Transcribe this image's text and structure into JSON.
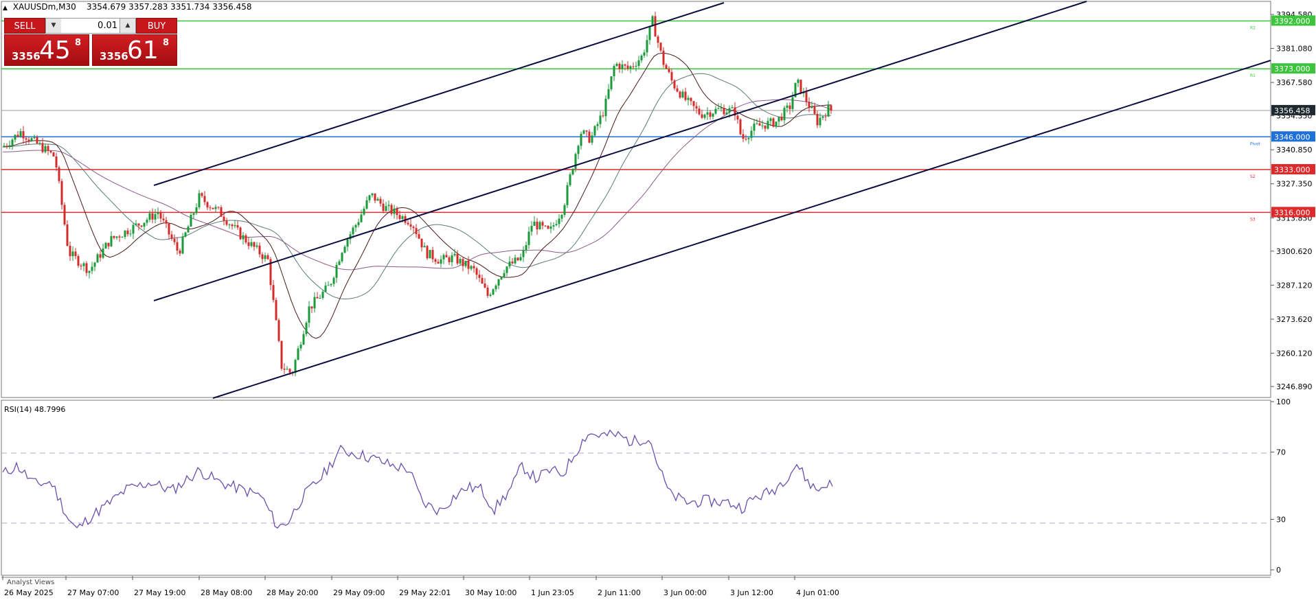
{
  "header": {
    "symbol_info": "XAUUSDm,M30",
    "ohlc": "3354.679 3357.283 3351.734 3356.458"
  },
  "trade_panel": {
    "sell_label": "SELL",
    "buy_label": "BUY",
    "lot_value": "0.01",
    "sell_price": {
      "prefix": "3356",
      "big": "45",
      "sup": "8"
    },
    "buy_price": {
      "prefix": "3356",
      "big": "61",
      "sup": "8"
    }
  },
  "price_axis": {
    "ticks": [
      "3394.580",
      "3381.080",
      "3367.580",
      "3354.350",
      "3340.850",
      "3327.350",
      "3313.850",
      "3300.620",
      "3287.120",
      "3273.620",
      "3260.120",
      "3246.890"
    ]
  },
  "levels": [
    {
      "value": 3392.0,
      "label": "3392.000",
      "tag": "R2",
      "color": "#3cc43c"
    },
    {
      "value": 3373.0,
      "label": "3373.000",
      "tag": "R1",
      "color": "#3cc43c"
    },
    {
      "value": 3346.0,
      "label": "3346.000",
      "tag": "Pivot",
      "color": "#1f6fd8"
    },
    {
      "value": 3333.0,
      "label": "3333.000",
      "tag": "S2",
      "color": "#dd2a2a"
    },
    {
      "value": 3316.0,
      "label": "3316.000",
      "tag": "S3",
      "color": "#dd2a2a"
    }
  ],
  "current_price": {
    "value": 3356.458,
    "label": "3356.458"
  },
  "time_axis": {
    "labels": [
      "26 May 2025",
      "27 May 07:00",
      "27 May 19:00",
      "28 May 08:00",
      "28 May 20:00",
      "29 May 09:00",
      "29 May 22:01",
      "30 May 10:00",
      "1 Jun 23:05",
      "2 Jun 11:00",
      "3 Jun 00:00",
      "3 Jun 12:00",
      "4 Jun 01:00"
    ]
  },
  "rsi": {
    "label": "RSI(14) 48.7996",
    "ticks": [
      "100",
      "70",
      "30",
      "0"
    ],
    "levels": [
      70,
      30
    ],
    "color": "#6a4fb0"
  },
  "footer": {
    "analyst_views": "Analyst Views"
  },
  "colors": {
    "bull": "#1a9a3a",
    "bear": "#d42b2b",
    "ma_dark": "#4a1818",
    "ma_mid": "#5a7a7a",
    "ma_purple": "#8a5a8a",
    "channel": "#0b0b40"
  }
}
